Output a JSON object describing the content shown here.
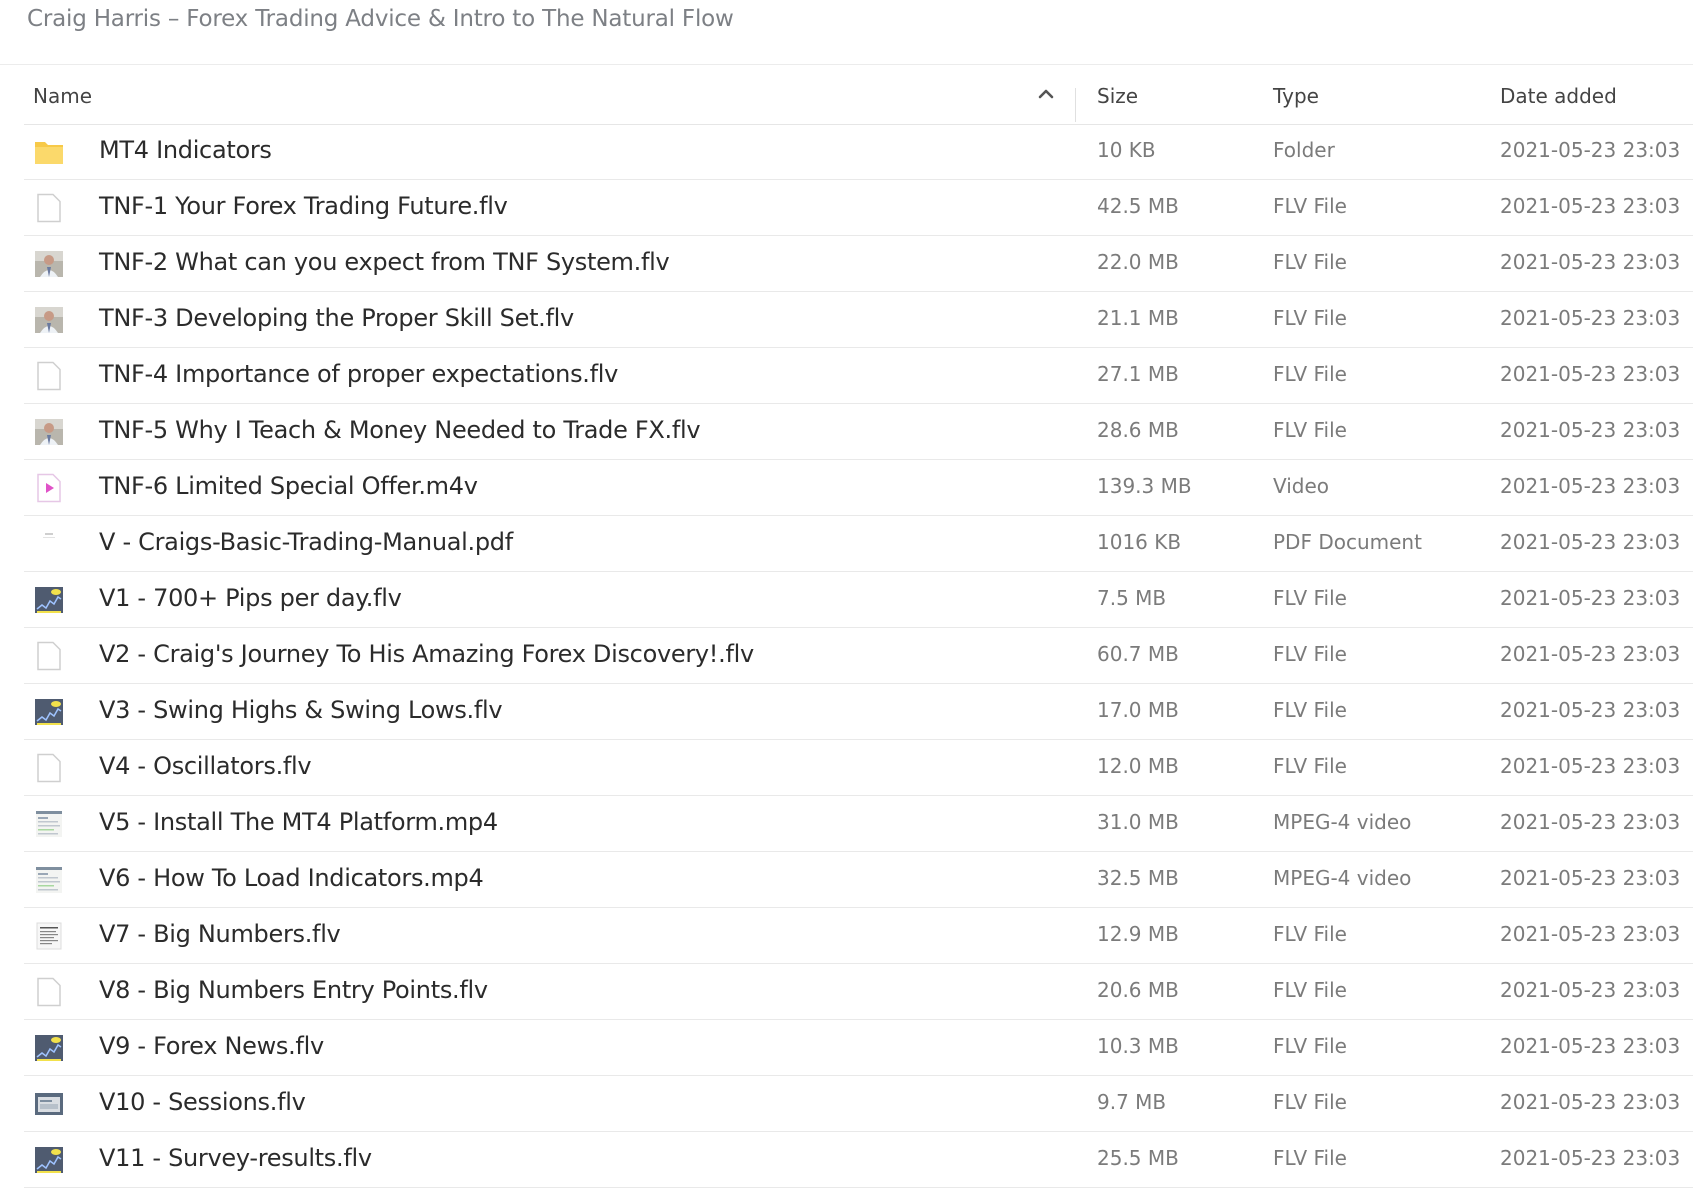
{
  "breadcrumb": "Craig Harris – Forex Trading Advice & Intro to The Natural Flow",
  "columns": {
    "name": "Name",
    "size": "Size",
    "type": "Type",
    "date": "Date added"
  },
  "sort": {
    "column": "name",
    "direction": "ascending"
  },
  "files": [
    {
      "name": "MT4 Indicators",
      "size": "10 KB",
      "type": "Folder",
      "date": "2021-05-23 23:03",
      "icon": "folder-icon"
    },
    {
      "name": "TNF-1 Your Forex Trading Future.flv",
      "size": "42.5 MB",
      "type": "FLV File",
      "date": "2021-05-23 23:03",
      "icon": "file-icon"
    },
    {
      "name": "TNF-2 What can you expect from TNF System.flv",
      "size": "22.0 MB",
      "type": "FLV File",
      "date": "2021-05-23 23:03",
      "icon": "video-thumbnail-person-icon"
    },
    {
      "name": "TNF-3 Developing the Proper Skill Set.flv",
      "size": "21.1 MB",
      "type": "FLV File",
      "date": "2021-05-23 23:03",
      "icon": "video-thumbnail-person-icon"
    },
    {
      "name": "TNF-4 Importance of proper expectations.flv",
      "size": "27.1 MB",
      "type": "FLV File",
      "date": "2021-05-23 23:03",
      "icon": "file-icon"
    },
    {
      "name": "TNF-5 Why I Teach & Money Needed to Trade FX.flv",
      "size": "28.6 MB",
      "type": "FLV File",
      "date": "2021-05-23 23:03",
      "icon": "video-thumbnail-person-icon"
    },
    {
      "name": "TNF-6 Limited Special Offer.m4v",
      "size": "139.3 MB",
      "type": "Video",
      "date": "2021-05-23 23:03",
      "icon": "video-file-icon"
    },
    {
      "name": "V - Craigs-Basic-Trading-Manual.pdf",
      "size": "1016 KB",
      "type": "PDF Document",
      "date": "2021-05-23 23:03",
      "icon": "pdf-thumbnail-icon"
    },
    {
      "name": "V1 - 700+ Pips per day.flv",
      "size": "7.5 MB",
      "type": "FLV File",
      "date": "2021-05-23 23:03",
      "icon": "chart-thumbnail-icon"
    },
    {
      "name": "V2 - Craig's Journey To His Amazing Forex Discovery!.flv",
      "size": "60.7 MB",
      "type": "FLV File",
      "date": "2021-05-23 23:03",
      "icon": "file-icon"
    },
    {
      "name": "V3 - Swing Highs & Swing Lows.flv",
      "size": "17.0 MB",
      "type": "FLV File",
      "date": "2021-05-23 23:03",
      "icon": "chart-thumbnail-icon"
    },
    {
      "name": "V4 - Oscillators.flv",
      "size": "12.0 MB",
      "type": "FLV File",
      "date": "2021-05-23 23:03",
      "icon": "file-icon"
    },
    {
      "name": "V5 - Install The MT4 Platform.mp4",
      "size": "31.0 MB",
      "type": "MPEG-4 video",
      "date": "2021-05-23 23:03",
      "icon": "screenshot-thumbnail-icon"
    },
    {
      "name": "V6 - How To Load Indicators.mp4",
      "size": "32.5 MB",
      "type": "MPEG-4 video",
      "date": "2021-05-23 23:03",
      "icon": "screenshot-thumbnail-icon"
    },
    {
      "name": "V7 - Big Numbers.flv",
      "size": "12.9 MB",
      "type": "FLV File",
      "date": "2021-05-23 23:03",
      "icon": "document-thumbnail-icon"
    },
    {
      "name": "V8 - Big Numbers Entry Points.flv",
      "size": "20.6 MB",
      "type": "FLV File",
      "date": "2021-05-23 23:03",
      "icon": "file-icon"
    },
    {
      "name": "V9 - Forex News.flv",
      "size": "10.3 MB",
      "type": "FLV File",
      "date": "2021-05-23 23:03",
      "icon": "chart-thumbnail-icon"
    },
    {
      "name": "V10 - Sessions.flv",
      "size": "9.7 MB",
      "type": "FLV File",
      "date": "2021-05-23 23:03",
      "icon": "window-thumbnail-icon"
    },
    {
      "name": "V11 - Survey-results.flv",
      "size": "25.5 MB",
      "type": "FLV File",
      "date": "2021-05-23 23:03",
      "icon": "chart-thumbnail-icon"
    }
  ]
}
